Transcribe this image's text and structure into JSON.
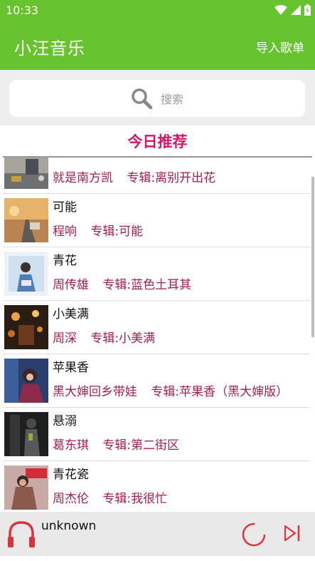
{
  "status_bar": {
    "time": "10:33"
  },
  "app_bar": {
    "title": "小汪音乐",
    "import_label": "导入歌单"
  },
  "search": {
    "placeholder": "搜索"
  },
  "section": {
    "title": "今日推荐"
  },
  "songs": [
    {
      "name": "",
      "artist": "就是南方凯",
      "album": "专辑:离别开出花"
    },
    {
      "name": "可能",
      "artist": "程响",
      "album": "专辑:可能"
    },
    {
      "name": "青花",
      "artist": "周传雄",
      "album": "专辑:蓝色土耳其"
    },
    {
      "name": "小美满",
      "artist": "周深",
      "album": "专辑:小美满"
    },
    {
      "name": "苹果香",
      "artist": "黑大婶回乡带娃",
      "album": "专辑:苹果香（黑大婶版）"
    },
    {
      "name": "悬溺",
      "artist": "葛东琪",
      "album": "专辑:第二街区"
    },
    {
      "name": "青花瓷",
      "artist": "周杰伦",
      "album": "专辑:我很忙"
    }
  ],
  "player": {
    "title": "unknown"
  },
  "colors": {
    "primary": "#66c22d",
    "accent": "#d4156a",
    "meta": "#a21d52",
    "icon": "#d9333f"
  },
  "icons": {
    "search": "search-icon",
    "headphones": "headphones-icon",
    "play": "play-circle-icon",
    "next": "skip-next-icon"
  }
}
